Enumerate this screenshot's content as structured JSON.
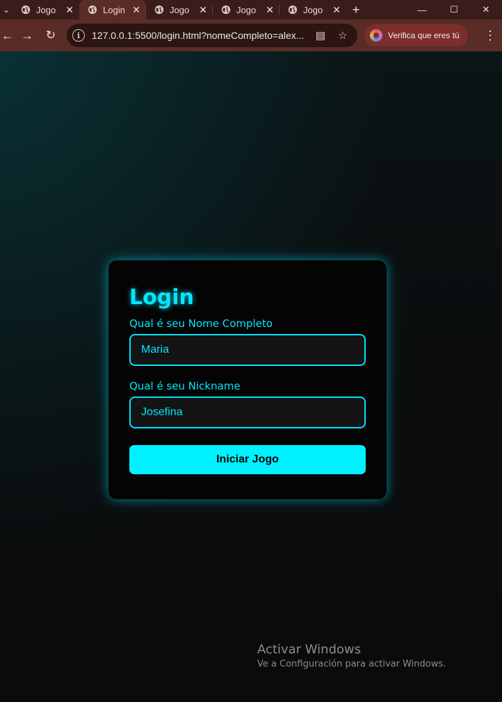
{
  "browser": {
    "tabs": [
      {
        "title": "Jogo",
        "active": false
      },
      {
        "title": "Login",
        "active": true
      },
      {
        "title": "Jogo",
        "active": false
      },
      {
        "title": "Jogo",
        "active": false
      },
      {
        "title": "Jogo",
        "active": false
      }
    ],
    "new_tab_glyph": "+",
    "url": "127.0.0.1:5500/login.html?nomeCompleto=alex...",
    "verify_chip_label": "Verifica que eres tú",
    "colors": {
      "tabstrip": "#3a1d1a",
      "toolbar": "#5a2c28",
      "omnibox": "#2a1513",
      "chip": "#7b2e2a"
    }
  },
  "login": {
    "title": "Login",
    "full_name_label": "Qual é seu Nome Completo",
    "full_name_value": "Maria",
    "nickname_label": "Qual é seu Nickname",
    "nickname_value": "Josefina",
    "start_button_label": "Iniciar Jogo",
    "accent_color": "#00e7ff"
  },
  "watermark": {
    "title": "Activar Windows",
    "subtitle": "Ve a Configuración para activar Windows."
  }
}
